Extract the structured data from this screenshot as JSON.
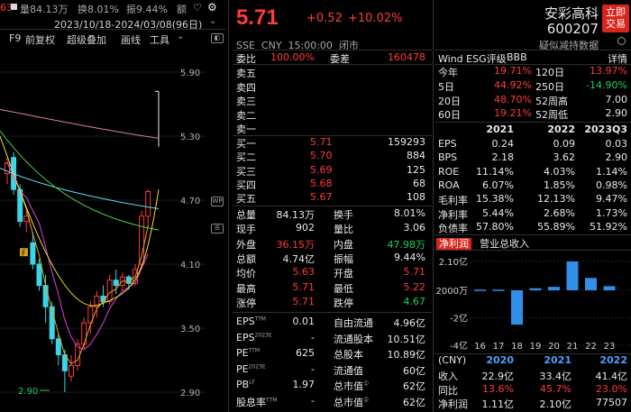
{
  "left": {
    "header": {
      "left_value": "63",
      "vol": "量84.13万",
      "turnover": "换8.01%",
      "amplitude": "振9.44%",
      "amount": "额"
    },
    "range": "2023/10/18-2024/03/08(96日)",
    "toolbar": [
      "F9",
      "前复权",
      "超级叠加",
      "画线",
      "工具"
    ],
    "y_ticks": [
      "5.90",
      "5.30",
      "4.70",
      "4.10",
      "3.50",
      "2.90"
    ],
    "low_label": "2.90",
    "event_marker": "F",
    "icons": {
      "heart": "heart-icon",
      "gear": "gear-icon",
      "chevron": "chevron-down-icon"
    },
    "candles": [
      {
        "o": 4.95,
        "c": 5.05,
        "h": 5.1,
        "l": 4.85
      },
      {
        "o": 5.1,
        "c": 4.8,
        "h": 5.15,
        "l": 4.75
      },
      {
        "o": 4.8,
        "c": 4.5,
        "h": 4.85,
        "l": 4.45
      },
      {
        "o": 4.5,
        "c": 4.55,
        "h": 4.6,
        "l": 4.4
      },
      {
        "o": 4.3,
        "c": 4.1,
        "h": 4.4,
        "l": 4.05
      },
      {
        "o": 4.1,
        "c": 3.9,
        "h": 4.15,
        "l": 3.85
      },
      {
        "o": 3.9,
        "c": 3.7,
        "h": 4.0,
        "l": 3.55
      },
      {
        "o": 3.7,
        "c": 3.4,
        "h": 3.75,
        "l": 3.35
      },
      {
        "o": 3.4,
        "c": 3.25,
        "h": 3.45,
        "l": 3.15
      },
      {
        "o": 3.25,
        "c": 3.1,
        "h": 3.3,
        "l": 2.9
      },
      {
        "o": 3.05,
        "c": 3.15,
        "h": 3.25,
        "l": 3.0
      },
      {
        "o": 3.15,
        "c": 3.35,
        "h": 3.4,
        "l": 3.1
      },
      {
        "o": 3.35,
        "c": 3.55,
        "h": 3.6,
        "l": 3.3
      },
      {
        "o": 3.55,
        "c": 3.7,
        "h": 3.75,
        "l": 3.45
      },
      {
        "o": 3.7,
        "c": 3.8,
        "h": 3.85,
        "l": 3.6
      },
      {
        "o": 3.8,
        "c": 3.75,
        "h": 3.9,
        "l": 3.7
      },
      {
        "o": 3.75,
        "c": 3.95,
        "h": 4.0,
        "l": 3.72
      },
      {
        "o": 3.95,
        "c": 3.9,
        "h": 4.05,
        "l": 3.82
      },
      {
        "o": 3.9,
        "c": 3.98,
        "h": 4.02,
        "l": 3.85
      },
      {
        "o": 3.98,
        "c": 3.92,
        "h": 4.0,
        "l": 3.86
      },
      {
        "o": 3.92,
        "c": 4.05,
        "h": 4.1,
        "l": 3.9
      },
      {
        "o": 4.1,
        "c": 4.55,
        "h": 4.6,
        "l": 4.05
      },
      {
        "o": 4.55,
        "c": 4.78,
        "h": 4.8,
        "l": 4.45
      }
    ],
    "last_bar": {
      "l": 5.2,
      "h": 5.72
    }
  },
  "mid": {
    "price": "5.71",
    "change": "+0.52",
    "pct": "+10.02%",
    "info_line": "SSE  CNY  15:00:00  闭市",
    "weibi_label": "委比",
    "weibi_val": "100.00%",
    "weicha_label": "委差",
    "weicha_val": "160478",
    "asks": [
      {
        "label": "卖五",
        "price": "",
        "vol": ""
      },
      {
        "label": "卖四",
        "price": "",
        "vol": ""
      },
      {
        "label": "卖三",
        "price": "",
        "vol": ""
      },
      {
        "label": "卖二",
        "price": "",
        "vol": ""
      },
      {
        "label": "卖一",
        "price": "",
        "vol": ""
      }
    ],
    "bids": [
      {
        "label": "买一",
        "price": "5.71",
        "vol": "159293"
      },
      {
        "label": "买二",
        "price": "5.70",
        "vol": "884"
      },
      {
        "label": "买三",
        "price": "5.69",
        "vol": "125"
      },
      {
        "label": "买四",
        "price": "5.68",
        "vol": "68"
      },
      {
        "label": "买五",
        "price": "5.67",
        "vol": "108"
      }
    ],
    "stats": [
      {
        "l1": "总量",
        "v1": "84.13万",
        "l2": "换手",
        "v2": "8.01%",
        "c1": "white",
        "c2": "white"
      },
      {
        "l1": "现手",
        "v1": "902",
        "l2": "量比",
        "v2": "3.06",
        "c1": "white",
        "c2": "white"
      },
      {
        "l1": "外盘",
        "v1": "36.15万",
        "l2": "内盘",
        "v2": "47.98万",
        "c1": "red",
        "c2": "green"
      },
      {
        "l1": "总额",
        "v1": "4.74亿",
        "l2": "振幅",
        "v2": "9.44%",
        "c1": "white",
        "c2": "white"
      },
      {
        "l1": "均价",
        "v1": "5.63",
        "l2": "开盘",
        "v2": "5.71",
        "c1": "red",
        "c2": "red"
      },
      {
        "l1": "最高",
        "v1": "5.71",
        "l2": "最低",
        "v2": "5.22",
        "c1": "red",
        "c2": "red"
      },
      {
        "l1": "涨停",
        "v1": "5.71",
        "l2": "跌停",
        "v2": "4.67",
        "c1": "red",
        "c2": "green"
      }
    ],
    "fund": [
      {
        "l1": "EPS",
        "s1": "TTM",
        "v1": "0.01",
        "l2": "自由流通",
        "v2": "4.96亿"
      },
      {
        "l1": "EPS",
        "s1": "2023E",
        "v1": "-",
        "l2": "流通股本",
        "v2": "10.51亿"
      },
      {
        "l1": "PE",
        "s1": "TTM",
        "v1": "625",
        "l2": "总股本",
        "v2": "10.89亿"
      },
      {
        "l1": "PE",
        "s1": "2023E",
        "v1": "-",
        "l2": "流通值",
        "v2": "60亿"
      },
      {
        "l1": "PB",
        "s1": "LF",
        "v1": "1.97",
        "l2": "总市值",
        "s2": "①",
        "v2": "62亿"
      },
      {
        "l1": "股息率",
        "s1": "TTM",
        "v1": "-",
        "l2": "总市值",
        "s2": "②",
        "v2": "62亿"
      }
    ]
  },
  "right": {
    "name": "安彩高科",
    "code": "600207",
    "buy_button": "立即\n交易",
    "esg_link": "疑似减持数据",
    "esg_label": "Wind ESG评级",
    "esg_rating": "BBB",
    "esg_detail": "详情",
    "perf": [
      {
        "l1": "今年",
        "v1": "19.71%",
        "c1": "red",
        "l2": "120日",
        "v2": "13.97%",
        "c2": "red"
      },
      {
        "l1": "5日",
        "v1": "44.92%",
        "c1": "red",
        "l2": "250日",
        "v2": "-14.90%",
        "c2": "green"
      },
      {
        "l1": "20日",
        "v1": "48.70%",
        "c1": "red",
        "l2": "52周高",
        "v2": "7.00",
        "c2": "white"
      },
      {
        "l1": "60日",
        "v1": "19.21%",
        "c1": "red",
        "l2": "52周低",
        "v2": "2.90",
        "c2": "white"
      }
    ],
    "fin_header": [
      "2021",
      "2022",
      "2023Q3"
    ],
    "fin": [
      {
        "label": "EPS",
        "vals": [
          "0.24",
          "0.09",
          "0.03"
        ]
      },
      {
        "label": "BPS",
        "vals": [
          "2.18",
          "3.62",
          "2.90"
        ]
      },
      {
        "label": "ROE",
        "vals": [
          "11.14%",
          "4.03%",
          "1.14%"
        ]
      },
      {
        "label": "ROA",
        "vals": [
          "6.07%",
          "1.85%",
          "0.98%"
        ]
      },
      {
        "label": "毛利率",
        "vals": [
          "15.38%",
          "12.13%",
          "9.47%"
        ]
      },
      {
        "label": "净利率",
        "vals": [
          "5.44%",
          "2.68%",
          "1.73%"
        ]
      },
      {
        "label": "负债率",
        "vals": [
          "57.80%",
          "55.89%",
          "51.92%"
        ]
      }
    ],
    "tabs": [
      "净利润",
      "营业总收入"
    ],
    "bar_chart": {
      "y_ticks": [
        "2.10亿",
        "2000万",
        "-2亿",
        "-4亿"
      ],
      "x": [
        "16",
        "17",
        "18",
        "19",
        "20",
        "21",
        "22",
        "23"
      ],
      "values": [
        0.05,
        0.05,
        -2.5,
        0.15,
        0.25,
        2.1,
        0.9,
        0.3
      ]
    },
    "rev_header": {
      "unit": "(CNY)",
      "years": [
        "2020",
        "2021",
        "2022"
      ]
    },
    "rev": [
      {
        "label": "收入",
        "vals": [
          "22.9亿",
          "33.4亿",
          "41.4亿"
        ],
        "cls": [
          "white",
          "white",
          "white"
        ]
      },
      {
        "label": "同比",
        "vals": [
          "13.6%",
          "45.7%",
          "23.0%"
        ],
        "cls": [
          "red",
          "red",
          "red"
        ]
      },
      {
        "label": "净利润",
        "vals": [
          "1.11亿",
          "2.10亿",
          "77507"
        ],
        "cls": [
          "white",
          "white",
          "white"
        ]
      }
    ]
  }
}
